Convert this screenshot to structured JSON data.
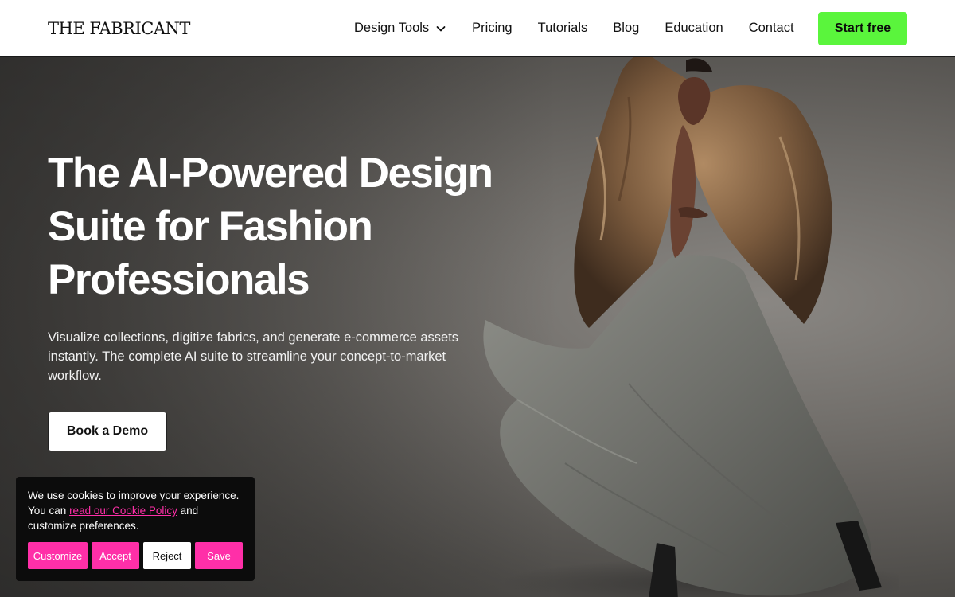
{
  "nav": {
    "logo": "THE FABRICANT",
    "links": [
      {
        "label": "Design Tools",
        "has_dropdown": true
      },
      {
        "label": "Pricing"
      },
      {
        "label": "Tutorials"
      },
      {
        "label": "Blog"
      },
      {
        "label": "Education"
      },
      {
        "label": "Contact"
      }
    ],
    "cta": "Start free",
    "cta_color": "#5af53c"
  },
  "hero": {
    "title": "The AI-Powered Design Suite for Fashion Professionals",
    "subtitle": "Visualize collections, digitize fabrics, and generate e-commerce assets instantly. The complete AI suite to streamline your concept-to-market workflow.",
    "button": "Book a Demo"
  },
  "cookie": {
    "text_before": "We use cookies to improve your experience. You can ",
    "link": "read our Cookie Policy",
    "text_after": " and customize preferences.",
    "buttons": {
      "customize": "Customize",
      "accept": "Accept",
      "reject": "Reject",
      "save": "Save"
    },
    "accent_color": "#ff2fa8"
  }
}
